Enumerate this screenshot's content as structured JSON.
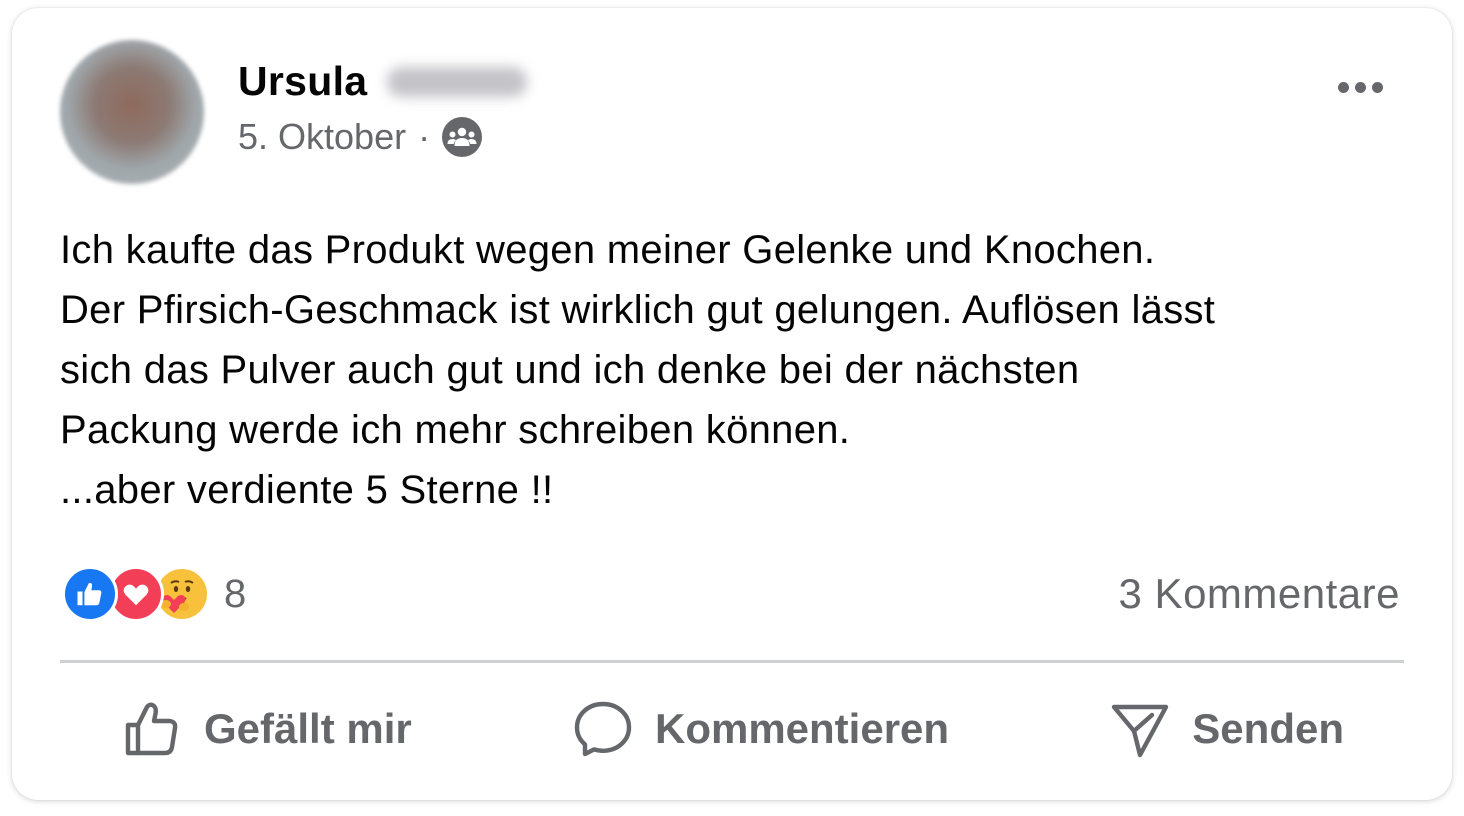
{
  "post": {
    "author_name": "Ursula",
    "date": "5. Oktober",
    "separator": "·",
    "audience_icon": "group-audience-icon",
    "more_icon": "more-horizontal-icon",
    "text_lines": [
      "Ich kaufte das Produkt wegen meiner Gelenke und Knochen.",
      "Der Pfirsich-Geschmack ist wirklich gut gelungen. Auflösen lässt",
      "sich das Pulver auch gut und ich denke bei der nächsten",
      "Packung werde ich mehr schreiben können.",
      "...aber verdiente 5 Sterne !!"
    ]
  },
  "reactions": {
    "types": [
      "like",
      "love",
      "care"
    ],
    "count": "8"
  },
  "comments": {
    "label": "3 Kommentare"
  },
  "actions": {
    "like": {
      "label": "Gefällt mir",
      "icon": "thumbs-up-icon"
    },
    "comment": {
      "label": "Kommentieren",
      "icon": "comment-bubble-icon"
    },
    "send": {
      "label": "Senden",
      "icon": "send-icon"
    }
  },
  "colors": {
    "text": "#050505",
    "secondary": "#65676b",
    "like_blue": "#1877f2",
    "love_red": "#f33e58",
    "care_yellow": "#f7c13b",
    "divider": "#ced0d4"
  }
}
